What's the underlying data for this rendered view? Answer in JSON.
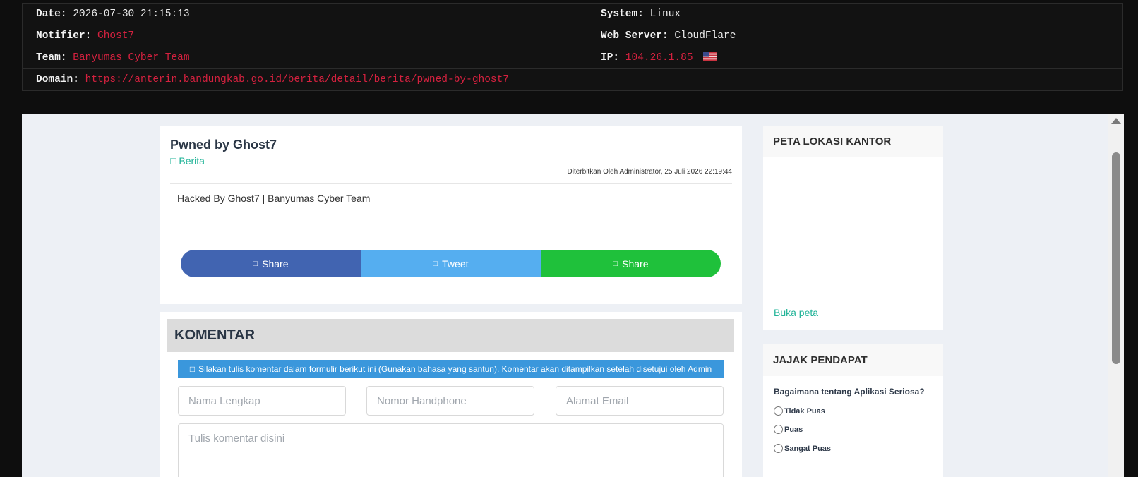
{
  "mirror": {
    "date_label": "Date:",
    "date_value": "2026-07-30 21:15:13",
    "notifier_label": "Notifier:",
    "notifier_value": "Ghost7",
    "team_label": "Team:",
    "team_value": "Banyumas Cyber Team",
    "domain_label": "Domain:",
    "domain_value": "https://anterin.bandungkab.go.id/berita/detail/berita/pwned-by-ghost7",
    "system_label": "System:",
    "system_value": "Linux",
    "webserver_label": "Web Server:",
    "webserver_value": "CloudFlare",
    "ip_label": "IP:",
    "ip_value": "104.26.1.85",
    "flag_icon": "us-flag-icon"
  },
  "article": {
    "title": "Pwned by Ghost7",
    "category_icon": "folder-icon",
    "category": "Berita",
    "meta": "Diterbitkan Oleh Administrator, 25 Juli 2026 22:19:44",
    "body": "Hacked By Ghost7 | Banyumas Cyber Team",
    "share_buttons": [
      {
        "label": "Share",
        "icon": "facebook-icon",
        "color": "#4164b1"
      },
      {
        "label": "Tweet",
        "icon": "twitter-icon",
        "color": "#55aef0"
      },
      {
        "label": "Share",
        "icon": "whatsapp-icon",
        "color": "#1fc13b"
      }
    ]
  },
  "comments": {
    "title": "KOMENTAR",
    "notice_icon": "info-icon",
    "notice": "Silakan tulis komentar dalam formulir berikut ini (Gunakan bahasa yang santun). Komentar akan ditampilkan setelah disetujui oleh Admin",
    "name_placeholder": "Nama Lengkap",
    "phone_placeholder": "Nomor Handphone",
    "email_placeholder": "Alamat Email",
    "comment_placeholder": "Tulis komentar disini"
  },
  "sidebar": {
    "map_title": "PETA LOKASI KANTOR",
    "map_link": "Buka peta",
    "poll_title": "JAJAK PENDAPAT",
    "poll_question": "Bagaimana tentang Aplikasi Seriosa?",
    "poll_options": [
      "Tidak Puas",
      "Puas",
      "Sangat Puas"
    ]
  },
  "colors": {
    "accent_red": "#d5213f",
    "accent_green": "#1fb397",
    "notice_blue": "#3a97dc"
  }
}
